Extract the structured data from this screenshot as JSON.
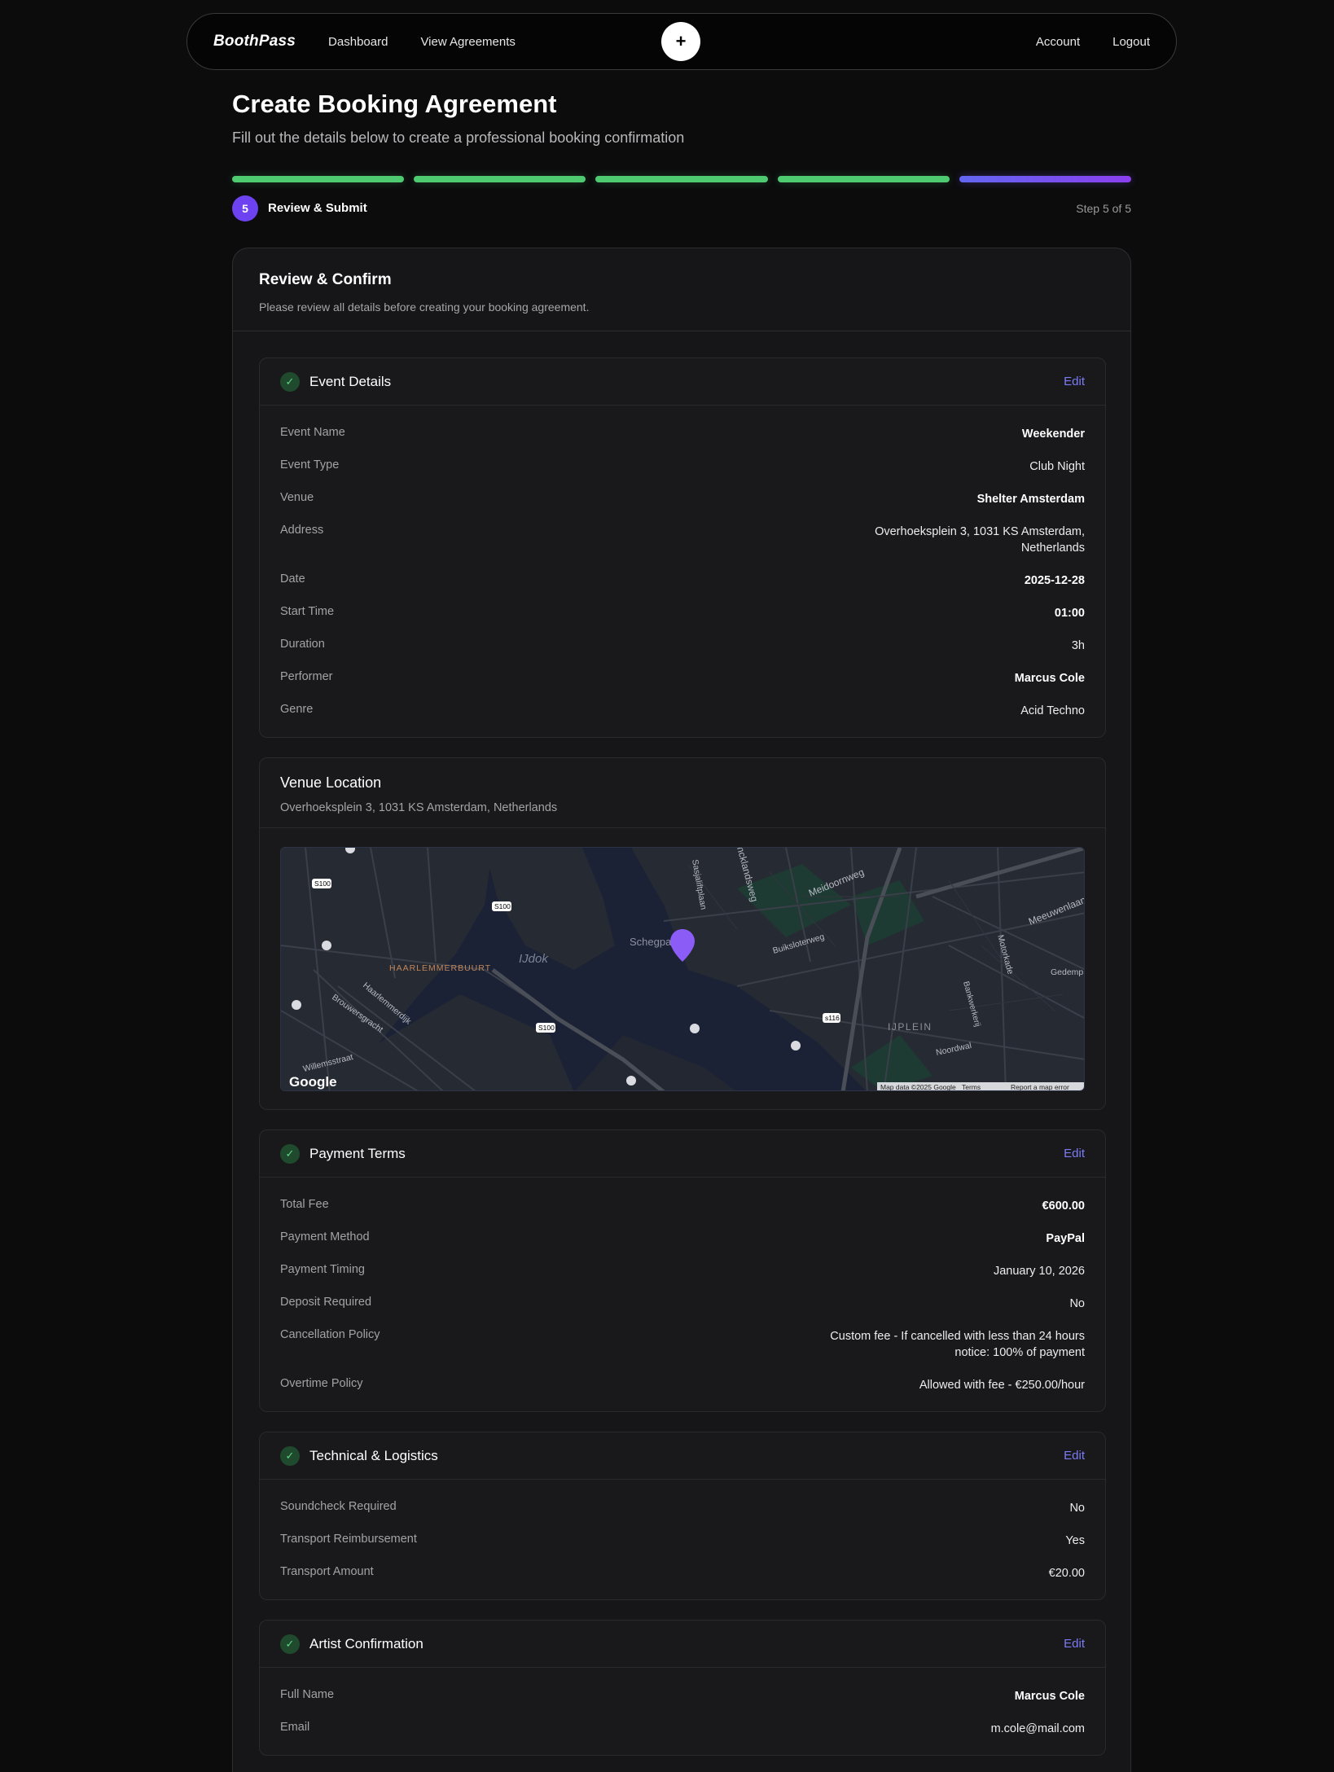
{
  "nav": {
    "brand": "BoothPass",
    "links": [
      "Dashboard",
      "View Agreements"
    ],
    "plus": "+",
    "right_links": [
      "Account",
      "Logout"
    ]
  },
  "page": {
    "title": "Create Booking Agreement",
    "subtitle": "Fill out the details below to create a professional booking confirmation"
  },
  "progress": {
    "completed_segments": 4,
    "total_segments": 5,
    "step_number": "5",
    "step_label": "Review & Submit",
    "step_count": "Step 5 of 5",
    "done_color": "#4ecb71",
    "active_color": "#7c4df0"
  },
  "review": {
    "title": "Review & Confirm",
    "subtitle": "Please review all details before creating your booking agreement."
  },
  "event_details": {
    "title": "Event Details",
    "edit": "Edit",
    "rows": [
      {
        "label": "Event Name",
        "value": "Weekender"
      },
      {
        "label": "Event Type",
        "value": "Club Night"
      },
      {
        "label": "Venue",
        "value": "Shelter Amsterdam"
      },
      {
        "label": "Address",
        "value": "Overhoeksplein 3, 1031 KS Amsterdam, Netherlands"
      },
      {
        "label": "Date",
        "value": "2025-12-28"
      },
      {
        "label": "Start Time",
        "value": "01:00"
      },
      {
        "label": "Duration",
        "value": "3h"
      },
      {
        "label": "Performer",
        "value": "Marcus Cole"
      },
      {
        "label": "Genre",
        "value": "Acid Techno"
      }
    ]
  },
  "venue_location": {
    "title": "Venue Location",
    "address": "Overhoeksplein 3, 1031 KS Amsterdam, Netherlands",
    "map": {
      "labels": {
        "haarlemmerbuurt": "HAARLEMMERBUURT",
        "ijdok": "IJdok",
        "schegpark": "Schegpark",
        "ijplein": "IJPLEIN",
        "meidoornweg": "Meidoornweg",
        "meeuwenlaan": "Meeuwenlaan",
        "buiksloterweg": "Buiksloterweg",
        "noordwal": "Noordwal",
        "motorkade": "Motorkade",
        "gedemp": "Gedemp",
        "haarlemmerdijk": "Haarlemmerdijk",
        "brouwersgracht": "Brouwersgracht",
        "willemsstraat": "Willemsstraat",
        "s100": "S100",
        "s116": "s116",
        "sasja": "Sasjaliftplaan",
        "ncklands": "ncklandsweg",
        "bankwerkerij": "Bankwerkerij"
      },
      "google": "Google",
      "attribution": [
        "Map data ©2025 Google",
        "Terms",
        "Report a map error"
      ]
    }
  },
  "payment_terms": {
    "title": "Payment Terms",
    "edit": "Edit",
    "rows": [
      {
        "label": "Total Fee",
        "value": "€600.00"
      },
      {
        "label": "Payment Method",
        "value": "PayPal"
      },
      {
        "label": "Payment Timing",
        "value": "January 10, 2026"
      },
      {
        "label": "Deposit Required",
        "value": "No"
      },
      {
        "label": "Cancellation Policy",
        "value": "Custom fee - If cancelled with less than 24 hours notice: 100% of payment"
      },
      {
        "label": "Overtime Policy",
        "value": "Allowed with fee - €250.00/hour"
      }
    ]
  },
  "technical": {
    "title": "Technical & Logistics",
    "edit": "Edit",
    "rows": [
      {
        "label": "Soundcheck Required",
        "value": "No"
      },
      {
        "label": "Transport Reimbursement",
        "value": "Yes"
      },
      {
        "label": "Transport Amount",
        "value": "€20.00"
      }
    ]
  },
  "artist": {
    "title": "Artist Confirmation",
    "edit": "Edit",
    "rows": [
      {
        "label": "Full Name",
        "value": "Marcus Cole"
      },
      {
        "label": "Email",
        "value": "m.cole@mail.com"
      }
    ]
  }
}
